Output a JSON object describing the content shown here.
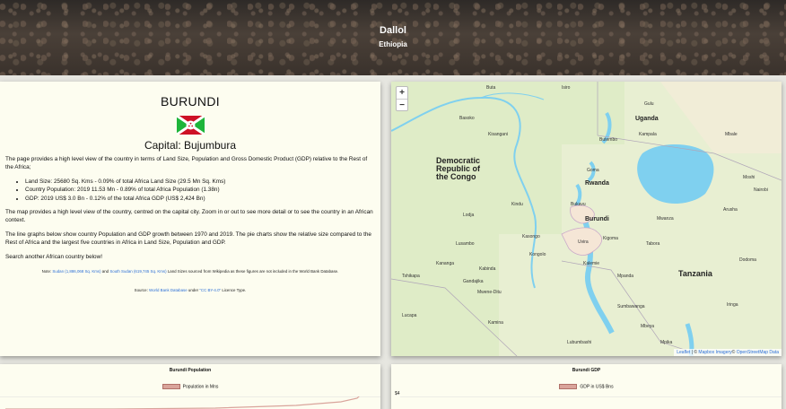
{
  "hero": {
    "title": "Dallol",
    "subtitle": "Ethiopia"
  },
  "info": {
    "country": "BURUNDI",
    "capital": "Capital: Bujumbura",
    "intro": "The page provides a high level view of the country in terms of Land Size, Population and Gross Domestic Product (GDP) relative to the Rest of the Africa;",
    "bullets": [
      "Land Size: 25680 Sq. Kms - 0.09% of total Africa Land Size (29.5 Mn Sq. Kms)",
      "Country Population: 2019 11.53 Mn - 0.89% of total Africa Population (1.38n)",
      "GDP: 2019 US$ 3.0 Bn - 0.12% of the total Africa GDP (US$ 2,424 Bn)"
    ],
    "map_text": "The map provides a high level view of the country, centred on the capital city. Zoom in or out to see more detail or to see the country in an African context.",
    "charts_text": "The line graphs below show country Population and GDP growth between 1970 and 2019. The pie charts show the relative size compared to the Rest of Africa and the largest five countries in Africa in Land Size, Population and GDP.",
    "search_text": "Search another African country below!",
    "note_prefix": "Note:",
    "note_sudan": "Sudan (1,886,068 Sq. Kms)",
    "note_and": "and",
    "note_south_sudan": "South Sudan (619,745 Sq. Kms)",
    "note_suffix": "Land Sizes sourced from Wikipedia as these figures are not included in the World Bank Database.",
    "source_prefix": "Source:",
    "source_link": "World Bank Database",
    "source_under": "under",
    "source_license": "\"CC BY-4.0\"",
    "source_suffix": "Licence Type."
  },
  "map": {
    "zoom_in": "+",
    "zoom_out": "−",
    "countries": {
      "drc": [
        "Democratic",
        "Republic of",
        "the Congo"
      ],
      "uganda": "Uganda",
      "rwanda": "Rwanda",
      "burundi": "Burundi",
      "tanzania": "Tanzania"
    },
    "cities": [
      "Buta",
      "Isiro",
      "Basoko",
      "Kisangani",
      "Butembo",
      "Gulu",
      "Kampala",
      "Nairobi",
      "Mbale",
      "Goma",
      "Bukavu",
      "Uvira",
      "Mwanza",
      "Arusha",
      "Moshi",
      "Kindu",
      "Kasongo",
      "Kalemie",
      "Kongolo",
      "Kananga",
      "Kabinda",
      "Gandajika",
      "Tshikapa",
      "Mwene-Ditu",
      "Kamina",
      "Mbeya",
      "Lubumbashi",
      "Sumbawanga",
      "Kigoma",
      "Tabora",
      "Dodoma",
      "Lodja",
      "Lusambo",
      "Lucapa",
      "Iringa",
      "Mpanda",
      "Mpika"
    ],
    "attribution_leaflet": "Leaflet",
    "attribution_sep": " | © ",
    "attribution_mapbox": "Mapbox Imagery",
    "attribution_osm": "OpenStreetMap Data"
  },
  "charts": {
    "population": {
      "title": "Burundi Population",
      "legend": "Population in Mns"
    },
    "gdp": {
      "title": "Burundi GDP",
      "legend": "GDP in US$ Bns",
      "y_tick_top": "$4"
    }
  },
  "colors": {
    "card_bg": "#fdfdf0",
    "water": "#7fd0ef",
    "link": "#2b6ed6",
    "series": "#d9a49b"
  }
}
